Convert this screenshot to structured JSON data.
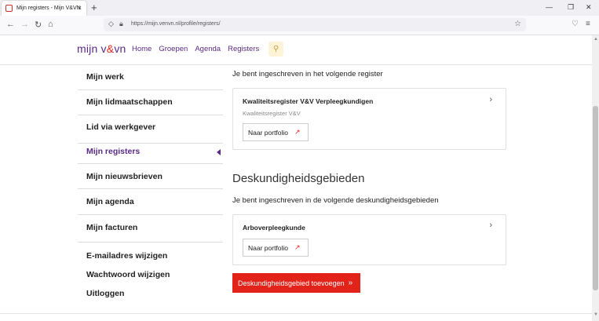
{
  "browser": {
    "tab_title": "Mijn registers - Mijn V&VN",
    "tab_close": "×",
    "new_tab": "+",
    "url": "https://mijn.venvn.nl/profile/registers/",
    "win_min": "—",
    "win_max": "❐",
    "win_close": "✕",
    "back": "←",
    "forward": "→",
    "reload": "↻",
    "home": "⌂",
    "star": "☆",
    "pocket": "♡",
    "menu": "≡"
  },
  "header": {
    "logo_pre": "mijn v",
    "logo_amp": "&",
    "logo_post": "vn",
    "nav": [
      "Home",
      "Groepen",
      "Agenda",
      "Registers"
    ]
  },
  "sidebar": {
    "items": [
      {
        "label": "Mijn werk"
      },
      {
        "label": "Mijn lidmaatschappen"
      },
      {
        "label": "Lid via werkgever"
      },
      {
        "label": "Mijn registers"
      },
      {
        "label": "Mijn nieuwsbrieven"
      },
      {
        "label": "Mijn agenda"
      },
      {
        "label": "Mijn facturen"
      }
    ],
    "links": [
      "E-mailadres wijzigen",
      "Wachtwoord wijzigen",
      "Uitloggen"
    ]
  },
  "main": {
    "registers_intro": "Je bent ingeschreven in het volgende register",
    "register_card": {
      "title": "Kwaliteitsregister V&V Verpleegkundigen",
      "subtitle": "Kwaliteitsregister V&V",
      "button": "Naar portfolio"
    },
    "expertise_heading": "Deskundigheidsgebieden",
    "expertise_intro": "Je bent ingeschreven in de volgende deskundigheidsgebieden",
    "expertise_card": {
      "title": "Arboverpleegkunde",
      "button": "Naar portfolio"
    },
    "add_button": "Deskundigheidsgebied toevoegen"
  },
  "colors": {
    "brand_purple": "#5b2a86",
    "brand_red": "#e2231a"
  }
}
